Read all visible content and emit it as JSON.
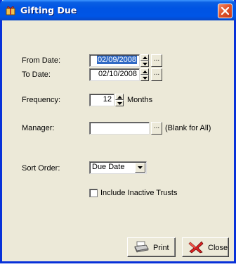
{
  "window": {
    "title": "Gifting Due"
  },
  "form": {
    "from_date": {
      "label": "From Date:",
      "value": "02/09/2008"
    },
    "to_date": {
      "label": "To Date:",
      "value": "02/10/2008"
    },
    "frequency": {
      "label": "Frequency:",
      "value": "12",
      "unit": "Months"
    },
    "manager": {
      "label": "Manager:",
      "value": "",
      "hint": "(Blank for All)"
    },
    "sort_order": {
      "label": "Sort Order:",
      "selected": "Due Date"
    },
    "include_inactive": {
      "label": "Include Inactive Trusts",
      "checked": false
    }
  },
  "buttons": {
    "print": "Print",
    "close": "Close"
  },
  "browse_label": "...",
  "colors": {
    "title_bar": "#0054e3",
    "dialog_bg": "#ece9d8",
    "selection": "#316ac5",
    "close_red": "#e0542b"
  }
}
